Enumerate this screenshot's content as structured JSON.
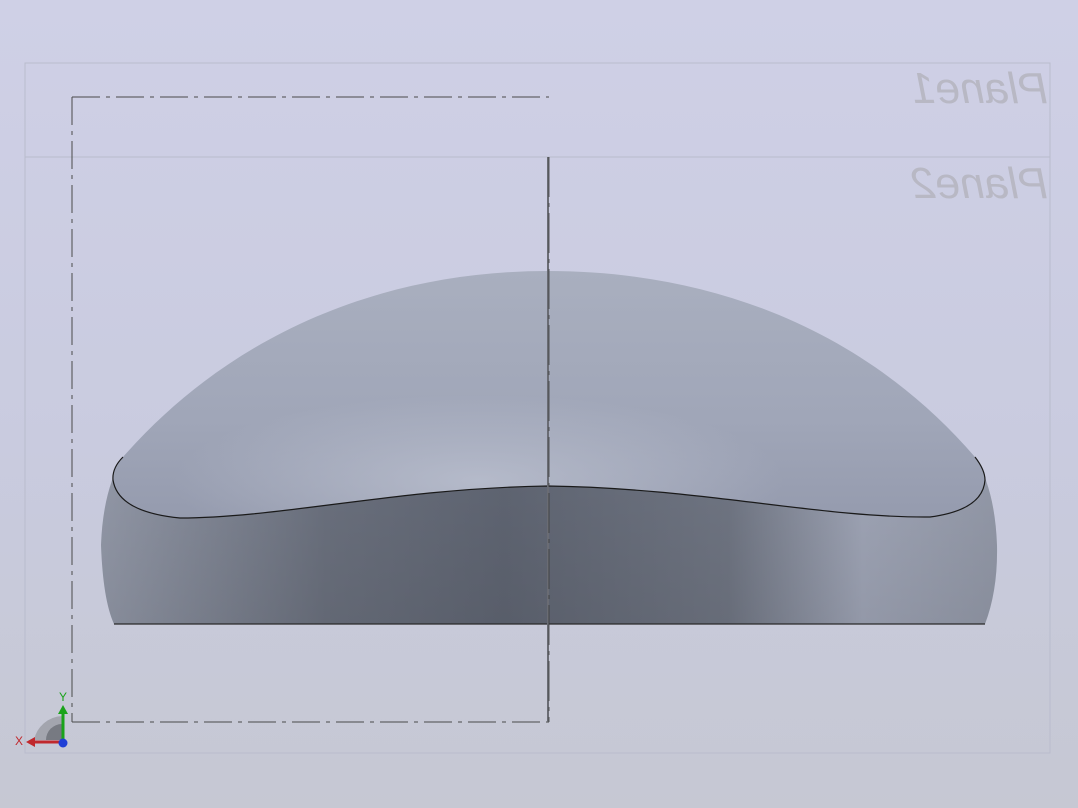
{
  "viewport": {
    "background_top": "#cfd0e6",
    "background_bottom": "#c6c8d3",
    "part_color": "#a7adbd",
    "edge_color": "#1a1a1a",
    "plane_border_color": "#b9bccd",
    "sketch_line_color": "#4a4a4a"
  },
  "planes": [
    {
      "name": "Plane1"
    },
    {
      "name": "Plane2"
    }
  ],
  "triad": {
    "x_label": "X",
    "y_label": "Y",
    "x_color": "#c0282d",
    "y_color": "#1aa31a",
    "z_color": "#1f3fd6"
  }
}
